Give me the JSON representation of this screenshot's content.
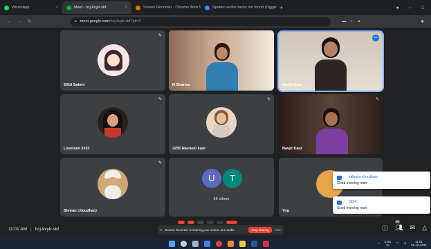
{
  "browser": {
    "tabs": [
      {
        "title": "WhatsApp",
        "color": "#25d366",
        "active": false
      },
      {
        "title": "Meet - hcj-kvyb-skf",
        "color": "#00ac47",
        "active": true
      },
      {
        "title": "Screen Recorder - Chrome Web Store",
        "color": "#e37400",
        "active": false
      },
      {
        "title": "Spoken audio tracks not found (Ogger)",
        "color": "#4285f4",
        "active": false
      }
    ],
    "new_tab": "+",
    "url_host": "meet.google.com",
    "url_path": "/hcj-kvyb-skf?pli=1"
  },
  "tiles": [
    {
      "name": "2016 Saloni",
      "kind": "avatar",
      "bg": "#fbe3ee"
    },
    {
      "name": "N Sharma",
      "kind": "video",
      "bg": "#b58a78"
    },
    {
      "name": "Navjit Kaur",
      "kind": "video",
      "bg": "#d8d0c6"
    },
    {
      "name": "Loveleen 2332",
      "kind": "avatar",
      "bg": "#2b2020"
    },
    {
      "name": "3255 Navneet kaur",
      "kind": "avatar",
      "bg": "#e9d6c2"
    },
    {
      "name": "Navjit Kaur",
      "kind": "video",
      "bg": "#3b2b26"
    },
    {
      "name": "Simran choudhary",
      "kind": "avatar",
      "bg": "#cfa874"
    },
    {
      "name": "56 others",
      "kind": "others",
      "bg": "#3c4043"
    },
    {
      "name": "You",
      "kind": "video",
      "bg": "#3c4043"
    }
  ],
  "others_avatars": [
    {
      "letter": "U",
      "color": "#5c6bc0"
    },
    {
      "letter": "T",
      "color": "#00897b"
    }
  ],
  "meeting": {
    "time": "11:01 AM",
    "code": "hcj-kvyb-skf"
  },
  "share_bar": {
    "text": "Screen Recorder is sharing your screen and audio.",
    "stop_label": "Stop sharing",
    "hide_label": "Hide"
  },
  "controls": {
    "people_count": "69"
  },
  "chat_toasts": [
    {
      "sender": "kalpana choudhary",
      "message": "Good morning mam"
    },
    {
      "sender": "3224",
      "message": "Good morning mam"
    }
  ],
  "tray": {
    "lang": "ENG",
    "region": "IN",
    "time": "11:01",
    "date": "21-10-2021"
  }
}
